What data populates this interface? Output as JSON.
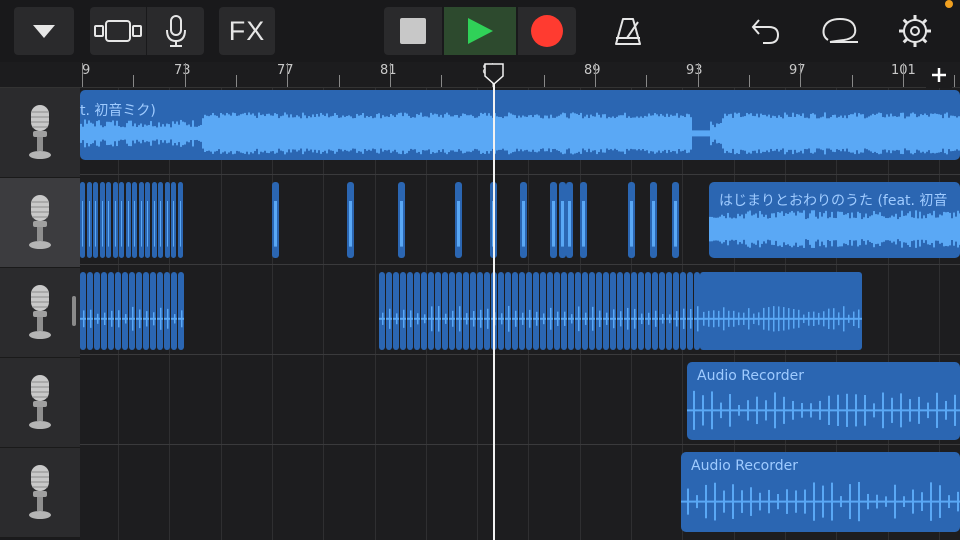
{
  "toolbar": {
    "fx_label": "FX"
  },
  "ruler": {
    "bar_labels": [
      "9",
      "73",
      "77",
      "81",
      "85",
      "89",
      "93",
      "97",
      "101"
    ]
  },
  "tracks": [
    {
      "instrument": "microphone-icon",
      "selected": false
    },
    {
      "instrument": "microphone-icon",
      "selected": true
    },
    {
      "instrument": "microphone-icon",
      "selected": false
    },
    {
      "instrument": "microphone-icon",
      "selected": false
    },
    {
      "instrument": "microphone-icon",
      "selected": false
    }
  ],
  "regions": {
    "track1_main": {
      "title": "t. 初音ミク)"
    },
    "track2_main": {
      "title": "はじまりとおわりのうた (feat. 初音"
    },
    "track4_main": {
      "title": "Audio Recorder"
    },
    "track5_main": {
      "title": "Audio Recorder"
    }
  },
  "colors": {
    "region": "#2b66b2",
    "waveform": "#5aa8f5",
    "record": "#ff3b30",
    "play": "#30d158"
  }
}
